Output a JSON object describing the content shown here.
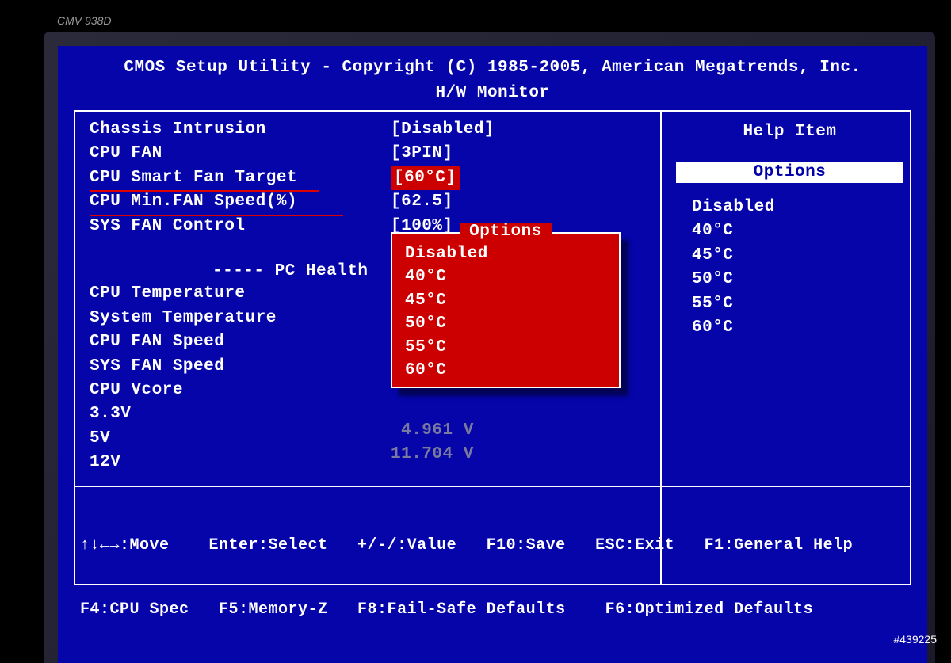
{
  "monitor_model": "CMV 938D",
  "header": {
    "title": "CMOS Setup Utility - Copyright (C) 1985-2005, American Megatrends, Inc.",
    "subtitle": "H/W Monitor"
  },
  "settings": [
    {
      "label": "Chassis Intrusion",
      "value": "[Disabled]",
      "highlight": false,
      "underline": ""
    },
    {
      "label": "CPU FAN",
      "value": "[3PIN]",
      "highlight": false,
      "underline": ""
    },
    {
      "label": "CPU Smart Fan Target",
      "value": "[60°C]",
      "highlight": true,
      "underline": "u1"
    },
    {
      "label": "CPU Min.FAN Speed(%)",
      "value": "[62.5]",
      "highlight": false,
      "underline": "u2"
    },
    {
      "label": "SYS FAN Control",
      "value": "[100%]",
      "highlight": false,
      "underline": ""
    }
  ],
  "pc_health_header": "----- PC Health",
  "pc_health": [
    "CPU Temperature",
    "System Temperature",
    "CPU FAN Speed",
    "SYS FAN Speed",
    "CPU Vcore",
    "3.3V",
    "5V",
    "12V"
  ],
  "dim_values": [
    " 4.961 V",
    "11.704 V"
  ],
  "popup": {
    "title": "Options",
    "items": [
      "Disabled",
      "40°C",
      "45°C",
      "50°C",
      "55°C",
      "60°C"
    ],
    "selected": "60°C"
  },
  "help": {
    "title": "Help Item",
    "options_label": "Options",
    "items": [
      "Disabled",
      "40°C",
      "45°C",
      "50°C",
      "55°C",
      "60°C"
    ]
  },
  "footer": {
    "line1": "↑↓←→:Move    Enter:Select   +/-/:Value   F10:Save   ESC:Exit   F1:General Help",
    "line2": "F4:CPU Spec   F5:Memory-Z   F8:Fail-Safe Defaults    F6:Optimized Defaults"
  },
  "watermark": "#439225"
}
